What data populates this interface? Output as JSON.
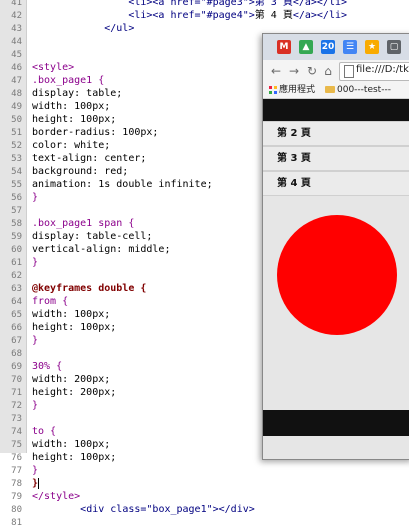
{
  "editor": {
    "lines": [
      {
        "n": "41",
        "parts": [
          {
            "t": "                ",
            "c": "txt"
          },
          {
            "t": "<li><a href=\"#page3\">第 3 頁</a></li>",
            "c": "tag"
          }
        ]
      },
      {
        "n": "42",
        "parts": [
          {
            "t": "                ",
            "c": "txt"
          },
          {
            "t": "<li><a href=\"#page4\">",
            "c": "tag"
          },
          {
            "t": "第 4 頁",
            "c": "txt"
          },
          {
            "t": "</a></li>",
            "c": "tag"
          }
        ]
      },
      {
        "n": "43",
        "parts": [
          {
            "t": "            ",
            "c": "txt"
          },
          {
            "t": "</ul>",
            "c": "tag"
          }
        ]
      },
      {
        "n": "44",
        "parts": []
      },
      {
        "n": "45",
        "parts": []
      },
      {
        "n": "46",
        "parts": [
          {
            "t": "<style>",
            "c": "sel"
          }
        ]
      },
      {
        "n": "47",
        "parts": [
          {
            "t": ".box_page1 {",
            "c": "sel"
          }
        ]
      },
      {
        "n": "48",
        "parts": [
          {
            "t": "display: table;",
            "c": "prop"
          }
        ]
      },
      {
        "n": "49",
        "parts": [
          {
            "t": "width: 100px;",
            "c": "prop"
          }
        ]
      },
      {
        "n": "50",
        "parts": [
          {
            "t": "height: 100px;",
            "c": "prop"
          }
        ]
      },
      {
        "n": "51",
        "parts": [
          {
            "t": "border-radius: 100px;",
            "c": "prop"
          }
        ]
      },
      {
        "n": "52",
        "parts": [
          {
            "t": "color: white;",
            "c": "prop"
          }
        ]
      },
      {
        "n": "53",
        "parts": [
          {
            "t": "text-align: center;",
            "c": "prop"
          }
        ]
      },
      {
        "n": "54",
        "parts": [
          {
            "t": "background: red;",
            "c": "prop"
          }
        ]
      },
      {
        "n": "55",
        "parts": [
          {
            "t": "animation: 1s double infinite;",
            "c": "prop"
          }
        ]
      },
      {
        "n": "56",
        "parts": [
          {
            "t": "}",
            "c": "sel"
          }
        ]
      },
      {
        "n": "57",
        "parts": []
      },
      {
        "n": "58",
        "parts": [
          {
            "t": ".box_page1 span {",
            "c": "sel"
          }
        ]
      },
      {
        "n": "59",
        "parts": [
          {
            "t": "display: table-cell;",
            "c": "prop"
          }
        ]
      },
      {
        "n": "60",
        "parts": [
          {
            "t": "vertical-align: middle;",
            "c": "prop"
          }
        ]
      },
      {
        "n": "61",
        "parts": [
          {
            "t": "}",
            "c": "sel"
          }
        ]
      },
      {
        "n": "62",
        "parts": []
      },
      {
        "n": "63",
        "parts": [
          {
            "t": "@keyframes double {",
            "c": "key"
          }
        ]
      },
      {
        "n": "64",
        "parts": [
          {
            "t": "from {",
            "c": "sel"
          }
        ]
      },
      {
        "n": "65",
        "parts": [
          {
            "t": "width: 100px;",
            "c": "prop"
          }
        ]
      },
      {
        "n": "66",
        "parts": [
          {
            "t": "height: 100px;",
            "c": "prop"
          }
        ]
      },
      {
        "n": "67",
        "parts": [
          {
            "t": "}",
            "c": "sel"
          }
        ]
      },
      {
        "n": "68",
        "parts": []
      },
      {
        "n": "69",
        "parts": [
          {
            "t": "30% {",
            "c": "sel"
          }
        ]
      },
      {
        "n": "70",
        "parts": [
          {
            "t": "width: 200px;",
            "c": "prop"
          }
        ]
      },
      {
        "n": "71",
        "parts": [
          {
            "t": "height: 200px;",
            "c": "prop"
          }
        ]
      },
      {
        "n": "72",
        "parts": [
          {
            "t": "}",
            "c": "sel"
          }
        ]
      },
      {
        "n": "73",
        "parts": []
      },
      {
        "n": "74",
        "parts": [
          {
            "t": "to {",
            "c": "sel"
          }
        ]
      },
      {
        "n": "75",
        "parts": [
          {
            "t": "width: 100px;",
            "c": "prop"
          }
        ]
      },
      {
        "n": "76",
        "parts": [
          {
            "t": "height: 100px;",
            "c": "prop"
          }
        ]
      },
      {
        "n": "77",
        "parts": [
          {
            "t": "}",
            "c": "sel"
          }
        ]
      },
      {
        "n": "78",
        "parts": [
          {
            "t": "}",
            "c": "key"
          }
        ],
        "caret": true
      },
      {
        "n": "79",
        "parts": [
          {
            "t": "</style>",
            "c": "sel"
          }
        ]
      },
      {
        "n": "80",
        "parts": [
          {
            "t": "        ",
            "c": "txt"
          },
          {
            "t": "<div class=\"box_page1\"></div>",
            "c": "tag"
          }
        ]
      },
      {
        "n": "81",
        "parts": []
      }
    ]
  },
  "browser": {
    "tab_icons": [
      {
        "name": "gmail-tab-icon",
        "label": "M",
        "color": "#d93025"
      },
      {
        "name": "drive-tab-icon",
        "label": "▲",
        "color": "#34a853"
      },
      {
        "name": "tab-20-icon",
        "label": "20",
        "color": "#1a73e8"
      },
      {
        "name": "doc-tab-icon",
        "label": "☰",
        "color": "#4285f4"
      },
      {
        "name": "favorite-tab-icon",
        "label": "★",
        "color": "#f9ab00"
      },
      {
        "name": "app-tab-icon",
        "label": "▢",
        "color": "#5f6368"
      },
      {
        "name": "github-tab-icon",
        "label": "◉",
        "color": "#24292e"
      }
    ],
    "url": "file:///D:/tku",
    "bookmarks": {
      "apps": "應用程式",
      "folder": "000---test---"
    },
    "nav_items": [
      "第 2 頁",
      "第 3 頁",
      "第 4 頁"
    ],
    "circle_color": "#ff0000"
  }
}
